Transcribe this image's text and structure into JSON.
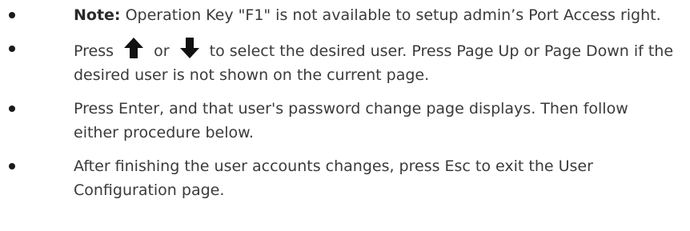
{
  "items": [
    {
      "note_label": "Note:",
      "text": " Operation Key \"F1\" is not available to setup admin’s Port Access right."
    },
    {
      "text_before": "Press",
      "text_between": "or",
      "text_after": "to select the desired user. Press Page Up or Page Down if the desired user is not shown on the current page.",
      "icons": [
        "arrow-up-icon",
        "arrow-down-icon"
      ]
    },
    {
      "text": "Press Enter, and that user's password change page displays. Then follow either procedure below."
    },
    {
      "text": "After finishing the user accounts changes, press Esc to exit the User Configuration page."
    }
  ],
  "colors": {
    "text": "#3a3a3a",
    "bullet": "#1a1a1a",
    "icon": "#111111"
  }
}
